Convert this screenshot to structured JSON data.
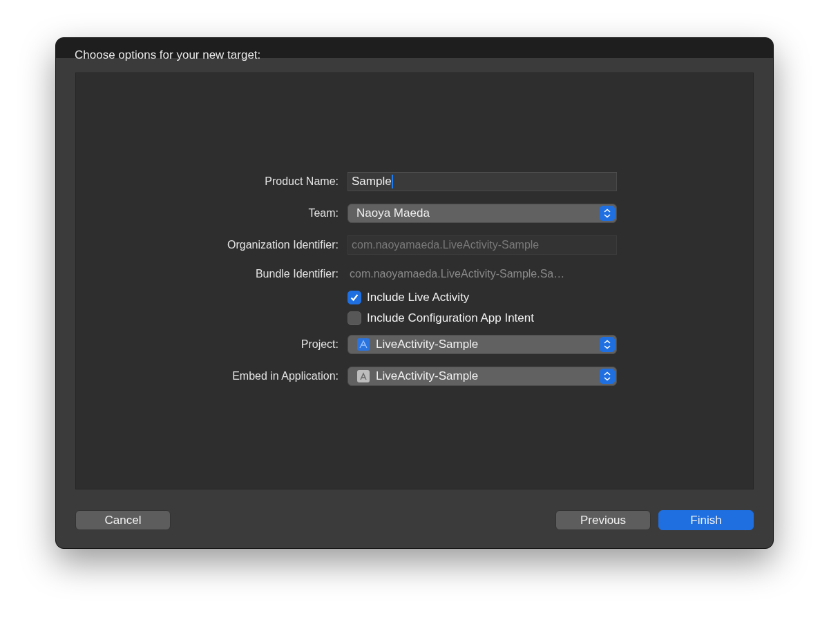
{
  "window": {
    "title": "Choose options for your new target:"
  },
  "form": [
    {
      "kind": "field",
      "label": "Product Name:",
      "value": "Sample",
      "focused": true,
      "disabled": false
    },
    {
      "kind": "popup",
      "label": "Team:",
      "value": "Naoya Maeda"
    },
    {
      "kind": "field",
      "label": "Organization Identifier:",
      "placeholder": "com.naoyamaeda.LiveActivity-Sample",
      "focused": false,
      "disabled": true
    },
    {
      "kind": "static",
      "label": "Bundle Identifier:",
      "value": "com.naoyamaeda.LiveActivity-Sample.Sa…"
    },
    {
      "kind": "checkbox",
      "text": "Include Live Activity",
      "checked": true
    },
    {
      "kind": "checkbox",
      "text": "Include Configuration App Intent",
      "checked": false
    },
    {
      "kind": "project-popup",
      "label": "Project:",
      "value": "LiveActivity-Sample"
    },
    {
      "kind": "app-popup",
      "label": "Embed in Application:",
      "value": "LiveActivity-Sample"
    }
  ],
  "footer": {
    "left": [
      {
        "label": "Cancel",
        "primary": false
      }
    ],
    "right": [
      {
        "label": "Previous",
        "primary": false
      },
      {
        "label": "Finish",
        "primary": true
      }
    ]
  }
}
